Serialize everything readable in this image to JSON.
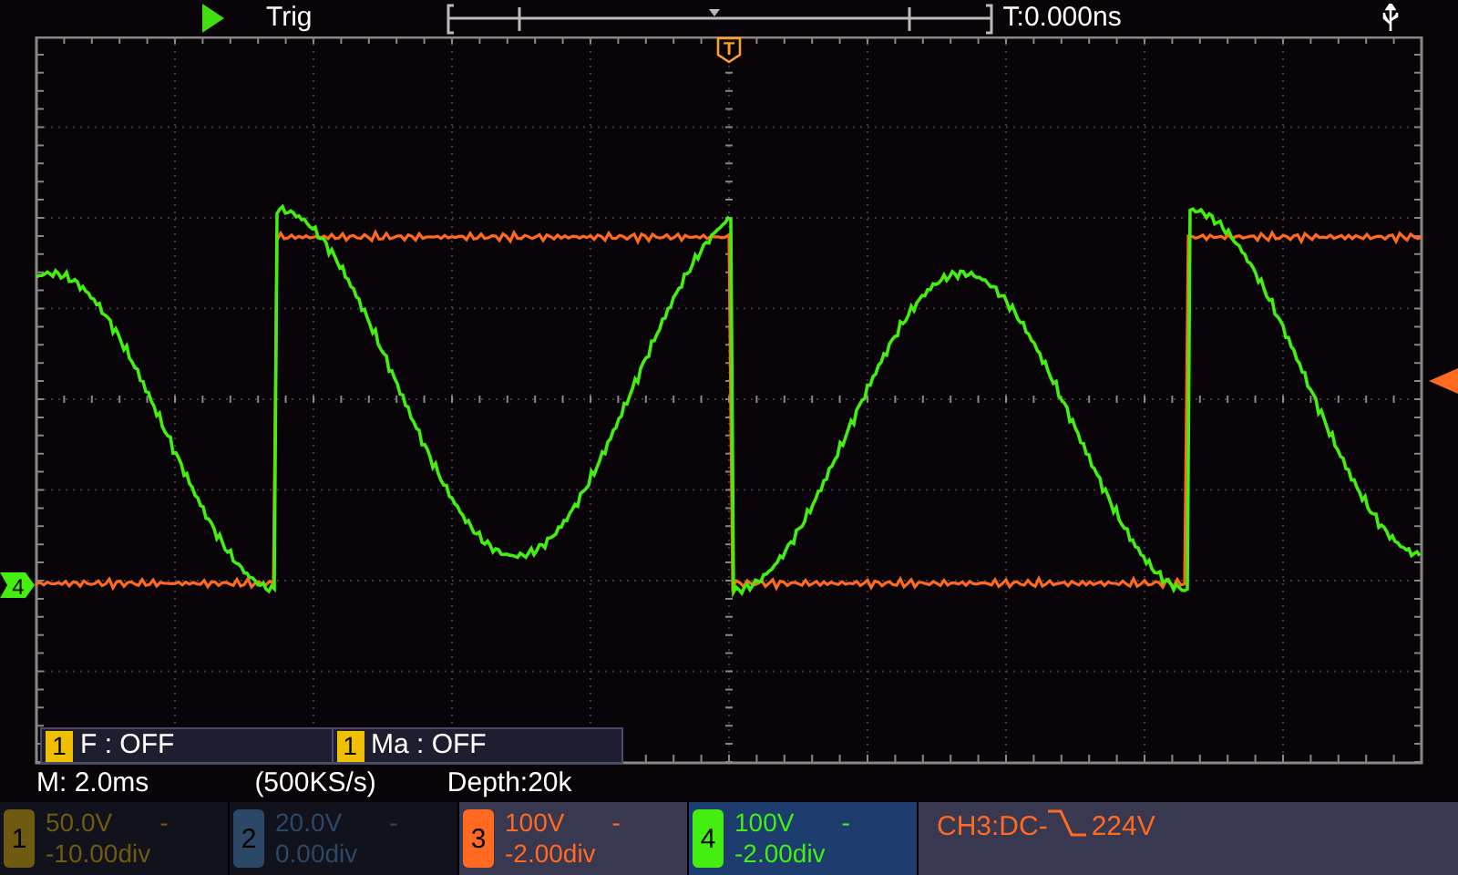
{
  "top_bar": {
    "running": true,
    "trigger_label": "Trig",
    "time_offset": "T:0.000ns"
  },
  "screen": {
    "trigger_position_marker": "T",
    "channel_markers": [
      {
        "label": "4",
        "color": "#44ee11"
      }
    ],
    "measurements": [
      {
        "channel": "1",
        "text": "F : OFF"
      },
      {
        "channel": "1",
        "text": "Ma : OFF"
      }
    ]
  },
  "status": {
    "timebase": "M: 2.0ms",
    "sample_rate": "(500KS/s)",
    "depth": "Depth:20k"
  },
  "channels": [
    {
      "number": "1",
      "volts": "50.0V",
      "coupling": "-",
      "offset": "-10.00div",
      "color": "#6e5a10",
      "enabled": false,
      "selected": false
    },
    {
      "number": "2",
      "volts": "20.0V",
      "coupling": "-",
      "offset": "0.00div",
      "color": "#2c4866",
      "enabled": false,
      "selected": false
    },
    {
      "number": "3",
      "volts": "100V",
      "coupling": "-",
      "offset": "-2.00div",
      "color": "#ff6a20",
      "enabled": true,
      "selected": false
    },
    {
      "number": "4",
      "volts": "100V",
      "coupling": "-",
      "offset": "-2.00div",
      "color": "#44ee11",
      "enabled": true,
      "selected": true
    }
  ],
  "trigger_info": {
    "source": "CH3:DC-",
    "level": "224V"
  }
}
